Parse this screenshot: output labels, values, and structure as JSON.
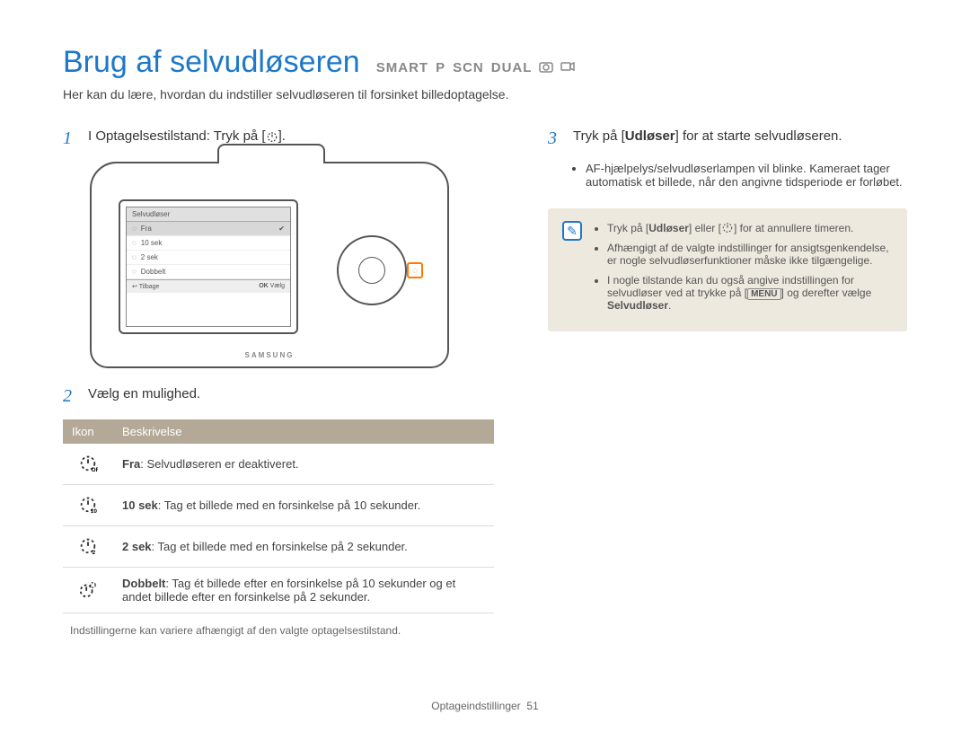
{
  "title": "Brug af selvudløseren",
  "modes": [
    "SMART",
    "P",
    "SCN",
    "DUAL"
  ],
  "intro": "Her kan du lære, hvordan du indstiller selvudløseren til forsinket billedoptagelse.",
  "steps": {
    "s1": {
      "num": "1",
      "text_before": "I Optagelsestilstand: Tryk på [",
      "text_after": "]."
    },
    "s2": {
      "num": "2",
      "text": "Vælg en mulighed."
    },
    "s3": {
      "num": "3",
      "text_before": "Tryk på [",
      "bold": "Udløser",
      "text_after": "] for at starte selvudløseren."
    }
  },
  "camera_screen": {
    "title": "Selvudløser",
    "rows": [
      {
        "label": "Fra",
        "selected": true
      },
      {
        "label": "10 sek",
        "selected": false
      },
      {
        "label": "2 sek",
        "selected": false
      },
      {
        "label": "Dobbelt",
        "selected": false
      }
    ],
    "back": "Tilbage",
    "ok": "Vælg",
    "brand": "SAMSUNG"
  },
  "table": {
    "head_icon": "Ikon",
    "head_desc": "Beskrivelse",
    "rows": [
      {
        "icon": "off",
        "bold": "Fra",
        "rest": ": Selvudløseren er deaktiveret."
      },
      {
        "icon": "10",
        "bold": "10 sek",
        "rest": ": Tag et billede med en forsinkelse på 10 sekunder."
      },
      {
        "icon": "2",
        "bold": "2 sek",
        "rest": ": Tag et billede med en forsinkelse på 2 sekunder."
      },
      {
        "icon": "double",
        "bold": "Dobbelt",
        "rest": ": Tag ét billede efter en forsinkelse på 10 sekunder og et andet billede efter en forsinkelse på 2 sekunder."
      }
    ]
  },
  "footnote": "Indstillingerne kan variere afhængigt af den valgte optagelsestilstand.",
  "s3_bullets": [
    "AF-hjælpelys/selvudløserlampen vil blinke. Kameraet tager automatisk et billede, når den angivne tidsperiode er forløbet."
  ],
  "note": {
    "b1_a": "Tryk på [",
    "b1_bold": "Udløser",
    "b1_b": "] eller [",
    "b1_c": "] for at annullere timeren.",
    "b2": "Afhængigt af de valgte indstillinger for ansigtsgenkendelse, er nogle selvudløserfunktioner måske ikke tilgængelige.",
    "b3_a": "I nogle tilstande kan du også angive indstillingen for selvudløser ved at trykke på [",
    "b3_menu": "MENU",
    "b3_b": "] og derefter vælge ",
    "b3_bold": "Selvudløser",
    "b3_c": "."
  },
  "footer": {
    "section": "Optageindstillinger",
    "page": "51"
  }
}
